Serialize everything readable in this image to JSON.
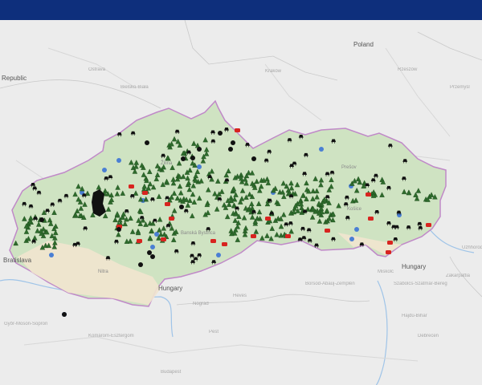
{
  "header": {
    "background": "#0e2f7c"
  },
  "map": {
    "base_color": "#ececec",
    "country_fill": "#cfe3c2",
    "border_color": "#c089c8",
    "country_labels": [
      "Poland",
      "Republic",
      "Hungary",
      "Hungary"
    ],
    "city_labels": [
      "Bratislava",
      "Banská Bystrica",
      "Košice",
      "Žilina",
      "Nitra",
      "Prešov"
    ],
    "faint_labels": [
      "Ostrava",
      "Bielsko-Biała",
      "Kraków",
      "Rzeszów",
      "Przemyśl",
      "Budapest",
      "Debrecen",
      "Miskolc",
      "Uzhhorod",
      "Győr-Moson-Sopron",
      "Komárom-Esztergom",
      "Nógrád",
      "Heves",
      "Borsod-Abaúj-Zemplén",
      "Szabolcs-Szatmár-Bereg",
      "Hajdú-Bihar",
      "Zakarpattia",
      "Pest"
    ],
    "marker_colors": {
      "city_dot": "#4a7fd4",
      "black_marker": "#111111",
      "red_marker": "#d8241f",
      "green_marker": "#2e6b2c"
    },
    "legend_types": [
      "city-dot",
      "black-dot",
      "red-animal",
      "green-tree",
      "black-animal"
    ]
  }
}
